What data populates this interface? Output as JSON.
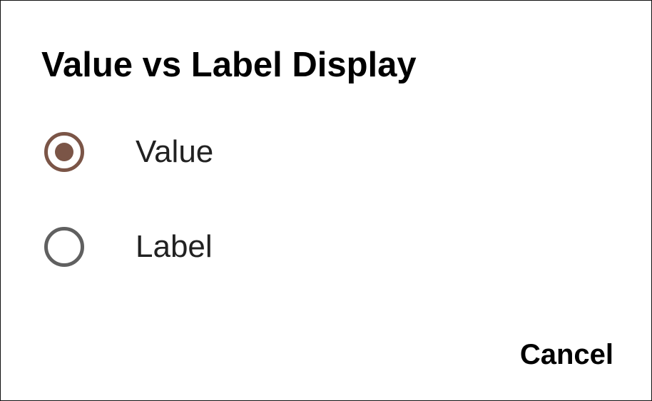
{
  "dialog": {
    "title": "Value vs Label Display",
    "options": [
      {
        "label": "Value",
        "selected": true
      },
      {
        "label": "Label",
        "selected": false
      }
    ],
    "cancel_label": "Cancel"
  },
  "colors": {
    "accent": "#7b5547",
    "radio_unchecked": "#606060",
    "text": "#212121"
  },
  "icons": {
    "radio_checked": "radio-checked-icon",
    "radio_unchecked": "radio-unchecked-icon"
  }
}
